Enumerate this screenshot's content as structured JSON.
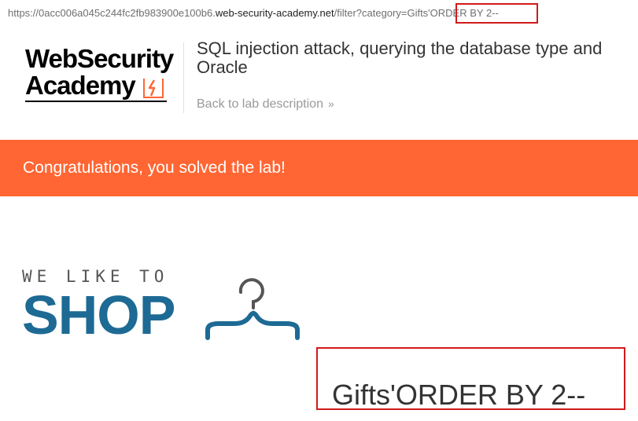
{
  "browser": {
    "url_prefix": "https://0acc006a045c244fc2fb983900e100b6.",
    "url_host": "web-security-academy.net",
    "url_path": "/filter?category=Gifts'ORDER BY 2--"
  },
  "header": {
    "logo_line1": "WebSecurity",
    "logo_line2": "Academy",
    "lab_title_line1": "SQL injection attack, querying the database type and",
    "lab_title_line2": "Oracle",
    "back_link_label": "Back to lab description",
    "back_link_chevron": "»"
  },
  "banner": {
    "message": "Congratulations, you solved the lab!",
    "color": "#ff6633"
  },
  "shop": {
    "tagline": "WE LIKE TO",
    "word": "SHOP",
    "color": "#1d6a94"
  },
  "main": {
    "category_title": "Gifts'ORDER BY 2--"
  },
  "annotations": {
    "highlight_color": "#d11a1a"
  }
}
